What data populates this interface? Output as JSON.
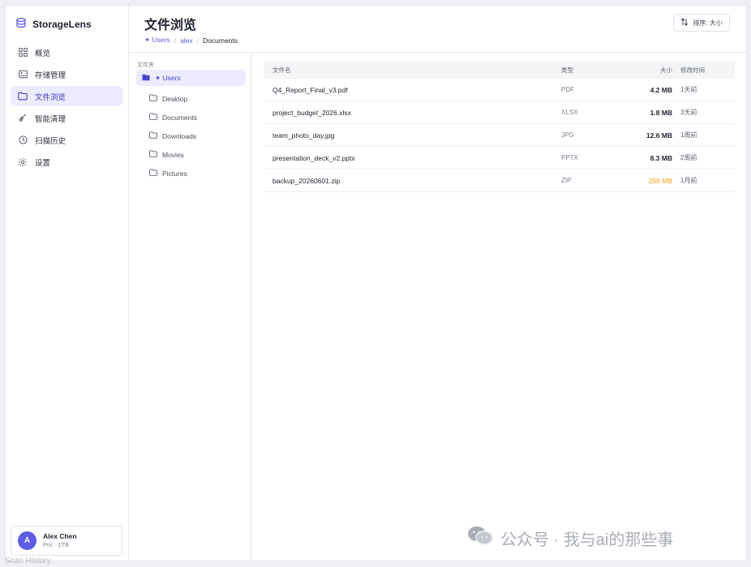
{
  "app": {
    "name": "StorageLens"
  },
  "sidebar": {
    "items": [
      {
        "label": "概览",
        "icon": "grid-icon",
        "active": false
      },
      {
        "label": "存储管理",
        "icon": "storage-icon",
        "active": false
      },
      {
        "label": "文件浏览",
        "icon": "folder-icon",
        "active": true
      },
      {
        "label": "智能清理",
        "icon": "broom-icon",
        "active": false
      },
      {
        "label": "扫描历史",
        "icon": "clock-icon",
        "active": false
      },
      {
        "label": "设置",
        "icon": "gear-icon",
        "active": false
      }
    ],
    "user": {
      "initial": "A",
      "name": "Alex Chen",
      "plan": "Pro · 1TB"
    }
  },
  "header": {
    "title": "文件浏览",
    "breadcrumb": {
      "root": "✦ Users",
      "sep": "/",
      "middle": "alex",
      "current": "Documents"
    },
    "sort_label": "排序: 大小"
  },
  "tree": {
    "label": "文件夹",
    "root": "✦ Users",
    "children": [
      "Desktop",
      "Documents",
      "Downloads",
      "Movies",
      "Pictures"
    ]
  },
  "files": {
    "headers": {
      "name": "文件名",
      "type": "类型",
      "size": "大小",
      "time": "修改时间"
    },
    "rows": [
      {
        "name": "Q4_Report_Final_v3.pdf",
        "type": "PDF",
        "size": "4.2 MB",
        "time": "1天前"
      },
      {
        "name": "project_budget_2026.xlsx",
        "type": "XLSX",
        "size": "1.8 MB",
        "time": "3天前"
      },
      {
        "name": "team_photo_day.jpg",
        "type": "JPG",
        "size": "12.6 MB",
        "time": "1周前"
      },
      {
        "name": "presentation_deck_v2.pptx",
        "type": "PPTX",
        "size": "8.3 MB",
        "time": "2周前"
      },
      {
        "name": "backup_20260601.zip",
        "type": "ZIP",
        "size": "256 MB",
        "time": "1月前"
      }
    ]
  },
  "colors": {
    "accent": "#5f5ce6",
    "active_bg": "#ecebff",
    "warn": "#f59e0b"
  },
  "watermark": {
    "text": "公众号 · 我与ai的那些事",
    "icon": "wechat-icon"
  },
  "footer": {
    "text": "Scan History"
  }
}
